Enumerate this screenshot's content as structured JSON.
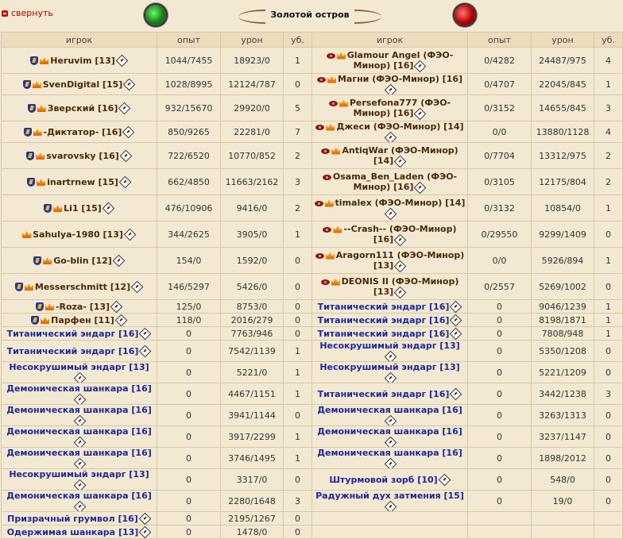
{
  "header": {
    "collapse_label": "свернуть",
    "title": "Золотой остров"
  },
  "columns": {
    "left": [
      "игрок",
      "опыт",
      "урон",
      "уб."
    ],
    "right": [
      "игрок",
      "опыт",
      "урон",
      "уб."
    ]
  },
  "rows": [
    {
      "tall": true,
      "left": {
        "name": "Heruvim [13]",
        "kind": "player",
        "icons": [
          "shield-icon",
          "crown-icon"
        ],
        "exp": "1044/7455",
        "dmg": "18923/0",
        "kills": "1"
      },
      "right": {
        "name": "Glamour Angel (ФЭО-Минор) [16]",
        "kind": "player",
        "icons": [
          "eye-icon",
          "crown-icon"
        ],
        "exp": "0/4282",
        "dmg": "24487/975",
        "kills": "4"
      }
    },
    {
      "tall": false,
      "left": {
        "name": "SvenDigital [15]",
        "kind": "player",
        "icons": [
          "shield-icon",
          "crown-icon"
        ],
        "exp": "1028/8995",
        "dmg": "12124/787",
        "kills": "0"
      },
      "right": {
        "name": "Магни (ФЭО-Минор) [16]",
        "kind": "player",
        "icons": [
          "eye-icon",
          "crown-icon"
        ],
        "exp": "0/4707",
        "dmg": "22045/845",
        "kills": "1"
      }
    },
    {
      "tall": true,
      "left": {
        "name": "Зверский [16]",
        "kind": "player",
        "icons": [
          "shield-icon",
          "crown-icon"
        ],
        "exp": "932/15670",
        "dmg": "29920/0",
        "kills": "5"
      },
      "right": {
        "name": "Persefona777 (ФЭО-Минор) [16]",
        "kind": "player",
        "icons": [
          "eye-icon",
          "crown-icon"
        ],
        "exp": "0/3152",
        "dmg": "14655/845",
        "kills": "3"
      }
    },
    {
      "tall": false,
      "left": {
        "name": "-Диктатор- [16]",
        "kind": "player",
        "icons": [
          "shield-icon",
          "crown-icon"
        ],
        "exp": "850/9265",
        "dmg": "22281/0",
        "kills": "7"
      },
      "right": {
        "name": "Джеси (ФЭО-Минор) [14]",
        "kind": "player",
        "icons": [
          "eye-icon",
          "crown-icon"
        ],
        "exp": "0/0",
        "dmg": "13880/1128",
        "kills": "4"
      }
    },
    {
      "tall": true,
      "left": {
        "name": "svarovsky [16]",
        "kind": "player",
        "icons": [
          "shield-icon",
          "crown-icon"
        ],
        "exp": "722/6520",
        "dmg": "10770/852",
        "kills": "2"
      },
      "right": {
        "name": "AntiqWar (ФЭО-Минор) [14]",
        "kind": "player",
        "icons": [
          "eye-icon",
          "crown-icon"
        ],
        "exp": "0/7704",
        "dmg": "13312/975",
        "kills": "2"
      }
    },
    {
      "tall": true,
      "left": {
        "name": "inartrnew [15]",
        "kind": "player",
        "icons": [
          "shield-icon",
          "crown-icon"
        ],
        "exp": "662/4850",
        "dmg": "11663/2162",
        "kills": "3"
      },
      "right": {
        "name": "Osama_Ben_Laden (ФЭО-Минор) [16]",
        "kind": "player",
        "icons": [
          "eye-icon"
        ],
        "exp": "0/3105",
        "dmg": "12175/804",
        "kills": "2"
      }
    },
    {
      "tall": true,
      "left": {
        "name": "Li1 [15]",
        "kind": "player",
        "icons": [
          "shield-icon",
          "crown-icon"
        ],
        "exp": "476/10906",
        "dmg": "9416/0",
        "kills": "2"
      },
      "right": {
        "name": "timalex (ФЭО-Минор) [14]",
        "kind": "player",
        "icons": [
          "eye-icon",
          "crown-icon"
        ],
        "exp": "0/3132",
        "dmg": "10854/0",
        "kills": "1"
      }
    },
    {
      "tall": true,
      "left": {
        "name": "Sahulya-1980 [13]",
        "kind": "player",
        "icons": [
          "crown-icon"
        ],
        "exp": "344/2625",
        "dmg": "3905/0",
        "kills": "1"
      },
      "right": {
        "name": "--Crash-- (ФЭО-Минор) [16]",
        "kind": "player",
        "icons": [
          "eye-icon",
          "crown-icon"
        ],
        "exp": "0/29550",
        "dmg": "9299/1409",
        "kills": "0"
      }
    },
    {
      "tall": true,
      "left": {
        "name": "Go-blin [12]",
        "kind": "player",
        "icons": [
          "shield-icon",
          "crown-icon"
        ],
        "exp": "154/0",
        "dmg": "1592/0",
        "kills": "0"
      },
      "right": {
        "name": "Aragorn111 (ФЭО-Минор) [13]",
        "kind": "player",
        "icons": [
          "eye-icon",
          "crown-icon"
        ],
        "exp": "0/0",
        "dmg": "5926/894",
        "kills": "1"
      }
    },
    {
      "tall": true,
      "left": {
        "name": "Messerschmitt [12]",
        "kind": "player",
        "icons": [
          "shield-icon",
          "crown-icon"
        ],
        "exp": "146/5297",
        "dmg": "5426/0",
        "kills": "0"
      },
      "right": {
        "name": "DEONIS II (ФЭО-Минор) [13]",
        "kind": "player",
        "icons": [
          "eye-icon",
          "crown-icon"
        ],
        "exp": "0/2557",
        "dmg": "5269/1002",
        "kills": "0"
      }
    },
    {
      "tall": false,
      "left": {
        "name": "-Roza- [13]",
        "kind": "player",
        "icons": [
          "shield-icon",
          "crown-icon"
        ],
        "exp": "125/0",
        "dmg": "8753/0",
        "kills": "0"
      },
      "right": {
        "name": "Титанический эндарг [16]",
        "kind": "bot",
        "icons": [],
        "exp": "0",
        "dmg": "9046/1239",
        "kills": "1"
      }
    },
    {
      "tall": false,
      "left": {
        "name": "Парфен [11]",
        "kind": "player",
        "icons": [
          "shield-icon",
          "crown-icon"
        ],
        "exp": "118/0",
        "dmg": "2016/279",
        "kills": "0"
      },
      "right": {
        "name": "Титанический эндарг [16]",
        "kind": "bot",
        "icons": [],
        "exp": "0",
        "dmg": "8198/1871",
        "kills": "1"
      }
    },
    {
      "tall": false,
      "left": {
        "name": "Титанический эндарг [16]",
        "kind": "bot",
        "icons": [],
        "exp": "0",
        "dmg": "7763/946",
        "kills": "0"
      },
      "right": {
        "name": "Титанический эндарг [16]",
        "kind": "bot",
        "icons": [],
        "exp": "0",
        "dmg": "7808/948",
        "kills": "1"
      }
    },
    {
      "tall": false,
      "left": {
        "name": "Титанический эндарг [16]",
        "kind": "bot",
        "icons": [],
        "exp": "0",
        "dmg": "7542/1139",
        "kills": "1"
      },
      "right": {
        "name": "Несокрушимый эндарг [13]",
        "kind": "bot",
        "icons": [],
        "exp": "0",
        "dmg": "5350/1208",
        "kills": "0"
      }
    },
    {
      "tall": false,
      "left": {
        "name": "Несокрушимый эндарг [13]",
        "kind": "bot",
        "icons": [],
        "exp": "0",
        "dmg": "5221/0",
        "kills": "1"
      },
      "right": {
        "name": "Несокрушимый эндарг [13]",
        "kind": "bot",
        "icons": [],
        "exp": "0",
        "dmg": "5221/1209",
        "kills": "0"
      }
    },
    {
      "tall": false,
      "left": {
        "name": "Демоническая шанкара [16]",
        "kind": "bot",
        "icons": [],
        "exp": "0",
        "dmg": "4467/1151",
        "kills": "1"
      },
      "right": {
        "name": "Титанический эндарг [16]",
        "kind": "bot",
        "icons": [],
        "exp": "0",
        "dmg": "3442/1238",
        "kills": "3"
      }
    },
    {
      "tall": false,
      "left": {
        "name": "Демоническая шанкара [16]",
        "kind": "bot",
        "icons": [],
        "exp": "0",
        "dmg": "3941/1144",
        "kills": "0"
      },
      "right": {
        "name": "Демоническая шанкара [16]",
        "kind": "bot",
        "icons": [],
        "exp": "0",
        "dmg": "3263/1313",
        "kills": "0"
      }
    },
    {
      "tall": false,
      "left": {
        "name": "Демоническая шанкара [16]",
        "kind": "bot",
        "icons": [],
        "exp": "0",
        "dmg": "3917/2299",
        "kills": "1"
      },
      "right": {
        "name": "Демоническая шанкара [16]",
        "kind": "bot",
        "icons": [],
        "exp": "0",
        "dmg": "3237/1147",
        "kills": "0"
      }
    },
    {
      "tall": false,
      "left": {
        "name": "Демоническая шанкара [16]",
        "kind": "bot",
        "icons": [],
        "exp": "0",
        "dmg": "3746/1495",
        "kills": "1"
      },
      "right": {
        "name": "Демоническая шанкара [16]",
        "kind": "bot",
        "icons": [],
        "exp": "0",
        "dmg": "1898/2012",
        "kills": "0"
      }
    },
    {
      "tall": false,
      "left": {
        "name": "Несокрушимый эндарг [13]",
        "kind": "bot",
        "icons": [],
        "exp": "0",
        "dmg": "3317/0",
        "kills": "0"
      },
      "right": {
        "name": "Штурмовой зорб [10]",
        "kind": "bot",
        "icons": [],
        "exp": "0",
        "dmg": "548/0",
        "kills": "0"
      }
    },
    {
      "tall": false,
      "left": {
        "name": "Демоническая шанкара [16]",
        "kind": "bot",
        "icons": [],
        "exp": "0",
        "dmg": "2280/1648",
        "kills": "3"
      },
      "right": {
        "name": "Радужный дух затмения [15]",
        "kind": "bot",
        "icons": [],
        "exp": "0",
        "dmg": "19/0",
        "kills": "0"
      }
    },
    {
      "tall": false,
      "left": {
        "name": "Призрачный грумвол [16]",
        "kind": "bot",
        "icons": [],
        "exp": "0",
        "dmg": "2195/1267",
        "kills": "0"
      },
      "right": null
    },
    {
      "tall": false,
      "left": {
        "name": "Одержимая шанкара [13]",
        "kind": "bot",
        "icons": [],
        "exp": "0",
        "dmg": "1478/0",
        "kills": "0"
      },
      "right": null
    }
  ]
}
